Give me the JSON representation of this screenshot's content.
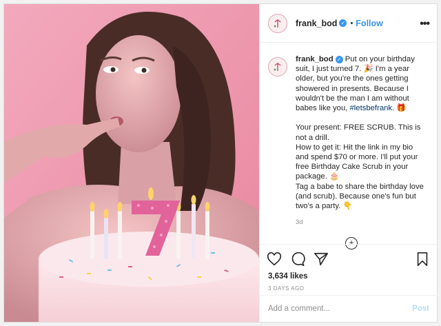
{
  "header": {
    "username": "frank_bod",
    "verified_icon": "✓",
    "separator": "•",
    "follow_label": "Follow",
    "more_label": "•••"
  },
  "caption": {
    "username": "frank_bod",
    "line1": " Put on your birthday suit, I just turned 7. 🎉 I'm a year older, but you're the ones getting showered in presents. Because I wouldn't be the man I am without babes like you, ",
    "hashtag": "#letsbefrank.",
    "line1_end": " 🎁",
    "present": "Your present: FREE SCRUB. This is not a drill.",
    "how": "How to get it: Hit the link in my bio and spend $70 or more. I'll put your free Birthday Cake Scrub in your package. 🎂",
    "tag": "Tag a babe to share the birthday love (and scrub). Because one's fun but two's a party. 👇",
    "age": "3d"
  },
  "load_more_label": "+",
  "actions": {
    "likes": "3,634 likes",
    "date": "3 DAYS AGO"
  },
  "comment_box": {
    "placeholder": "Add a comment...",
    "post_label": "Post"
  },
  "colors": {
    "accent": "#3897f0",
    "post_disabled": "#b2dffc",
    "photo_background": "#ef9db1"
  },
  "icons": [
    "heart-icon",
    "comment-icon",
    "share-icon",
    "bookmark-icon",
    "frank-logo-icon"
  ]
}
